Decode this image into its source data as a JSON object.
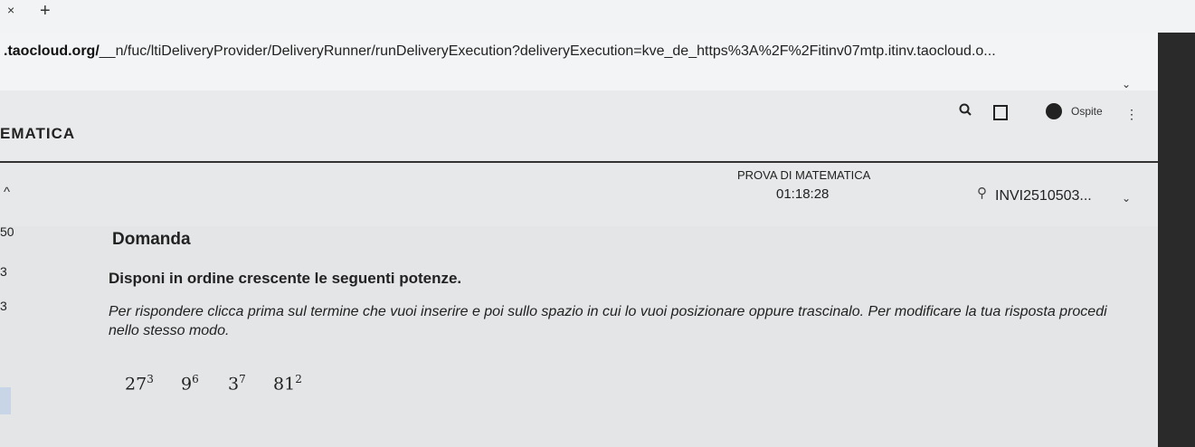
{
  "browser": {
    "tab_close": "×",
    "tab_new": "+",
    "url_host": ".taocloud.org/",
    "url_path": "__n/fuc/ltiDeliveryProvider/DeliveryRunner/runDeliveryExecution?deliveryExecution=kve_de_https%3A%2F%2Fitinv07mtp.itinv.taocloud.o...",
    "guest_label": "Ospite"
  },
  "app": {
    "title": "EMATICA",
    "test_name": "PROVA DI MATEMATICA",
    "timer": "01:18:28",
    "user_code": "INVI2510503..."
  },
  "sidebar": {
    "numbers": [
      "50",
      "3",
      "3"
    ]
  },
  "question": {
    "header": "Domanda",
    "title": "Disponi in ordine crescente le seguenti potenze.",
    "instructions": "Per rispondere clicca prima sul termine che vuoi inserire e poi sullo spazio in cui lo vuoi posizionare oppure trascinalo. Per modificare la tua risposta procedi nello stesso modo.",
    "choices": [
      {
        "base": "27",
        "exp": "3"
      },
      {
        "base": "9",
        "exp": "6"
      },
      {
        "base": "3",
        "exp": "7"
      },
      {
        "base": "81",
        "exp": "2"
      }
    ]
  }
}
